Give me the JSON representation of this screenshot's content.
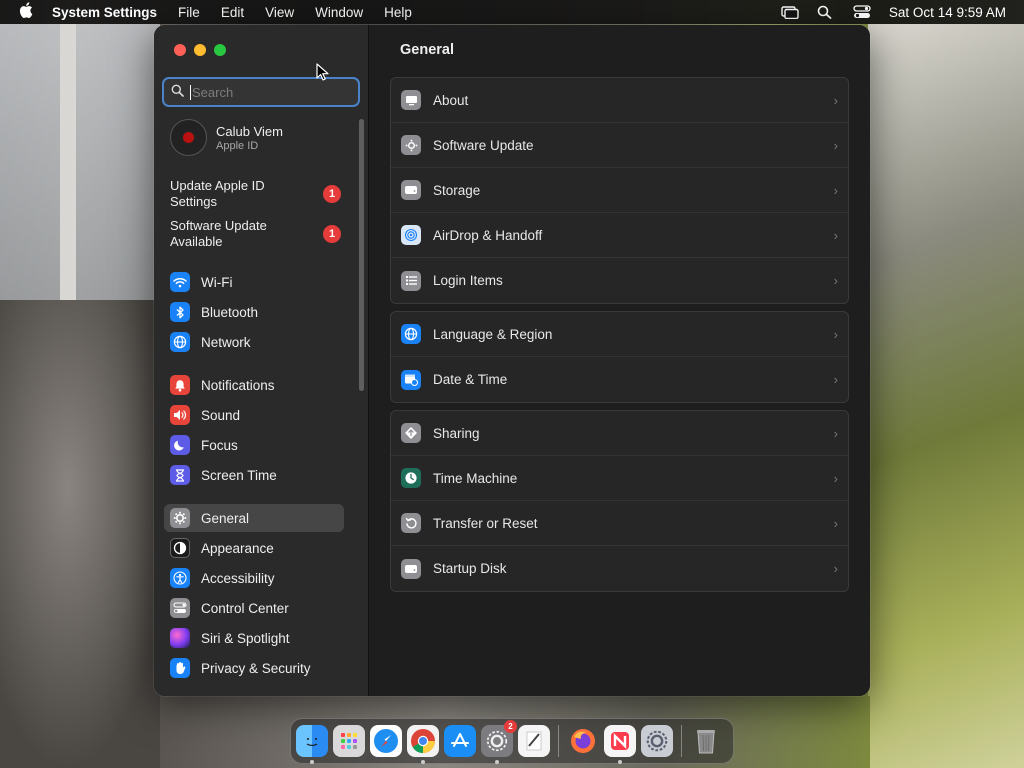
{
  "menubar": {
    "app_name": "System Settings",
    "menus": [
      "File",
      "Edit",
      "View",
      "Window",
      "Help"
    ],
    "clock": "Sat Oct 14  9:59 AM"
  },
  "sidebar": {
    "search_placeholder": "Search",
    "account": {
      "name": "Calub Viem",
      "subtitle": "Apple ID"
    },
    "alerts": [
      {
        "label": "Update Apple ID Settings",
        "count": "1"
      },
      {
        "label": "Software Update Available",
        "count": "1"
      }
    ],
    "items": [
      {
        "label": "Wi-Fi",
        "icon": "wifi-icon",
        "color": "#1a82f7"
      },
      {
        "label": "Bluetooth",
        "icon": "bluetooth-icon",
        "color": "#1a82f7"
      },
      {
        "label": "Network",
        "icon": "globe-icon",
        "color": "#1a82f7"
      },
      {
        "label": "Notifications",
        "icon": "bell-icon",
        "color": "#e7453a"
      },
      {
        "label": "Sound",
        "icon": "speaker-icon",
        "color": "#e7453a"
      },
      {
        "label": "Focus",
        "icon": "moon-icon",
        "color": "#5e5ce6"
      },
      {
        "label": "Screen Time",
        "icon": "hourglass-icon",
        "color": "#5e5ce6"
      },
      {
        "label": "General",
        "icon": "gear-icon",
        "color": "#8e8e93"
      },
      {
        "label": "Appearance",
        "icon": "appearance-icon",
        "color": "#1c1c1e"
      },
      {
        "label": "Accessibility",
        "icon": "accessibility-icon",
        "color": "#1a82f7"
      },
      {
        "label": "Control Center",
        "icon": "control-center-icon",
        "color": "#8e8e93"
      },
      {
        "label": "Siri & Spotlight",
        "icon": "siri-icon",
        "color": "#b050d8"
      },
      {
        "label": "Privacy & Security",
        "icon": "hand-icon",
        "color": "#1a82f7"
      }
    ],
    "selected": "General"
  },
  "content": {
    "title": "General",
    "groups": [
      [
        {
          "label": "About",
          "icon": "display-icon",
          "color": "#8e8e93"
        },
        {
          "label": "Software Update",
          "icon": "gear-badge-icon",
          "color": "#8e8e93"
        },
        {
          "label": "Storage",
          "icon": "drive-icon",
          "color": "#8e8e93"
        },
        {
          "label": "AirDrop & Handoff",
          "icon": "airdrop-icon",
          "color": "#d8e6f5"
        },
        {
          "label": "Login Items",
          "icon": "list-icon",
          "color": "#8e8e93"
        }
      ],
      [
        {
          "label": "Language & Region",
          "icon": "globe-icon",
          "color": "#1a82f7"
        },
        {
          "label": "Date & Time",
          "icon": "calendar-clock-icon",
          "color": "#1a82f7"
        }
      ],
      [
        {
          "label": "Sharing",
          "icon": "sharing-icon",
          "color": "#8e8e93"
        },
        {
          "label": "Time Machine",
          "icon": "time-machine-icon",
          "color": "#1f6e5a"
        },
        {
          "label": "Transfer or Reset",
          "icon": "reset-icon",
          "color": "#8e8e93"
        },
        {
          "label": "Startup Disk",
          "icon": "drive-icon",
          "color": "#8e8e93"
        }
      ]
    ]
  },
  "dock": {
    "apps": [
      {
        "name": "finder-icon",
        "color": "#2a8cf3",
        "running": true
      },
      {
        "name": "launchpad-icon",
        "color": "#d9d9d9",
        "running": false
      },
      {
        "name": "safari-icon",
        "color": "#1e8ef0",
        "running": false
      },
      {
        "name": "chrome-icon",
        "color": "#f2f2f2",
        "running": true
      },
      {
        "name": "app-store-icon",
        "color": "#1a8ef5",
        "running": false
      },
      {
        "name": "system-settings-icon",
        "color": "#7b7b80",
        "running": true,
        "badge": "2"
      },
      {
        "name": "textedit-icon",
        "color": "#f5f5f5",
        "running": false
      },
      {
        "name": "firefox-icon",
        "color": "#7a3fd8",
        "running": false
      },
      {
        "name": "news-icon",
        "color": "#f5f5f5",
        "running": true
      },
      {
        "name": "settings-utility-icon",
        "color": "#c9ccd3",
        "running": false
      },
      {
        "name": "trash-icon",
        "color": "#6a6a6a",
        "running": false
      }
    ]
  }
}
